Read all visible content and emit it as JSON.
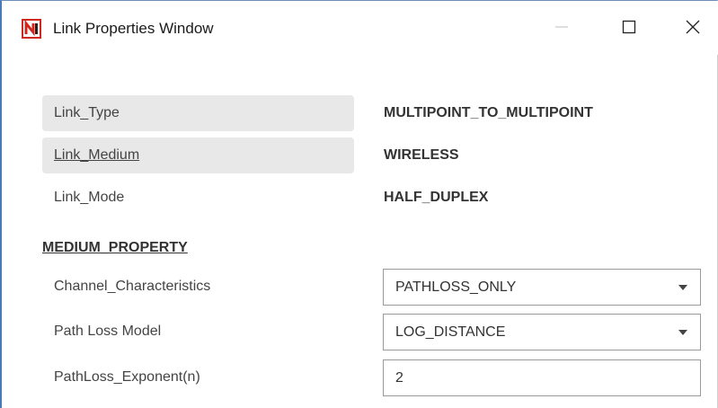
{
  "window": {
    "title": "Link Properties Window",
    "controls": [
      "minimize-icon",
      "maximize-icon",
      "close-icon"
    ]
  },
  "link_properties": [
    {
      "label": "Link_Type",
      "value": "MULTIPOINT_TO_MULTIPOINT"
    },
    {
      "label": "Link_Medium",
      "value": "WIRELESS"
    },
    {
      "label": "Link_Mode",
      "value": "HALF_DUPLEX"
    }
  ],
  "medium_property": {
    "header": "MEDIUM_PROPERTY",
    "channel_characteristics": {
      "label": "Channel_Characteristics",
      "value": "PATHLOSS_ONLY"
    },
    "path_loss_model": {
      "label": "Path Loss Model",
      "value": "LOG_DISTANCE"
    },
    "pathloss_exponent": {
      "label": "PathLoss_Exponent(n)",
      "value": "2"
    }
  },
  "colors": {
    "row_shade": "#e8e8e8",
    "icon_red": "#d0281e",
    "window_border": "#4a7ab8"
  }
}
